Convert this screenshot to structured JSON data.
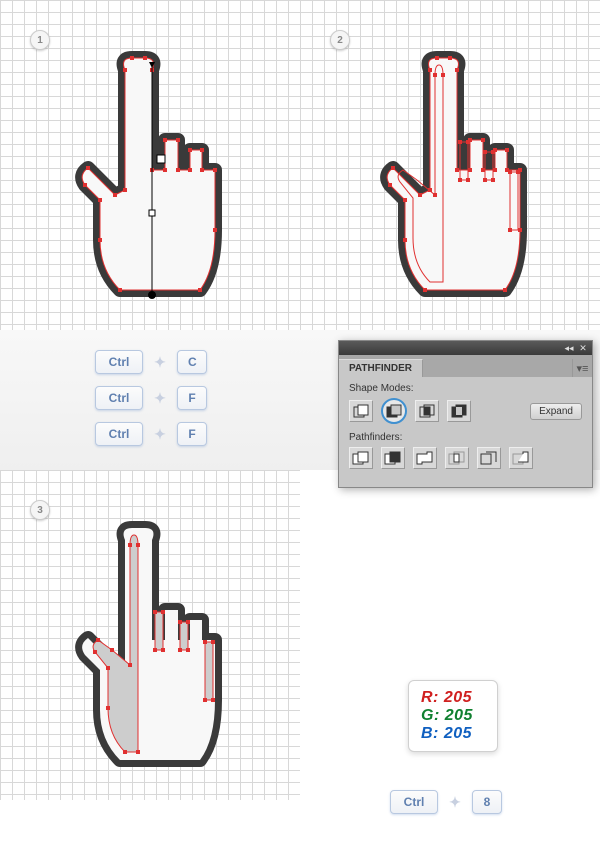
{
  "steps": {
    "one": "1",
    "two": "2",
    "three": "3"
  },
  "shortcuts": {
    "ctrl": "Ctrl",
    "c": "C",
    "f": "F",
    "eight": "8"
  },
  "pathfinder": {
    "title": "PATHFINDER",
    "shapeModesLabel": "Shape Modes:",
    "pathfindersLabel": "Pathfinders:",
    "expand": "Expand"
  },
  "rgb": {
    "r": "R: 205",
    "g": "G: 205",
    "b": "B: 205"
  }
}
